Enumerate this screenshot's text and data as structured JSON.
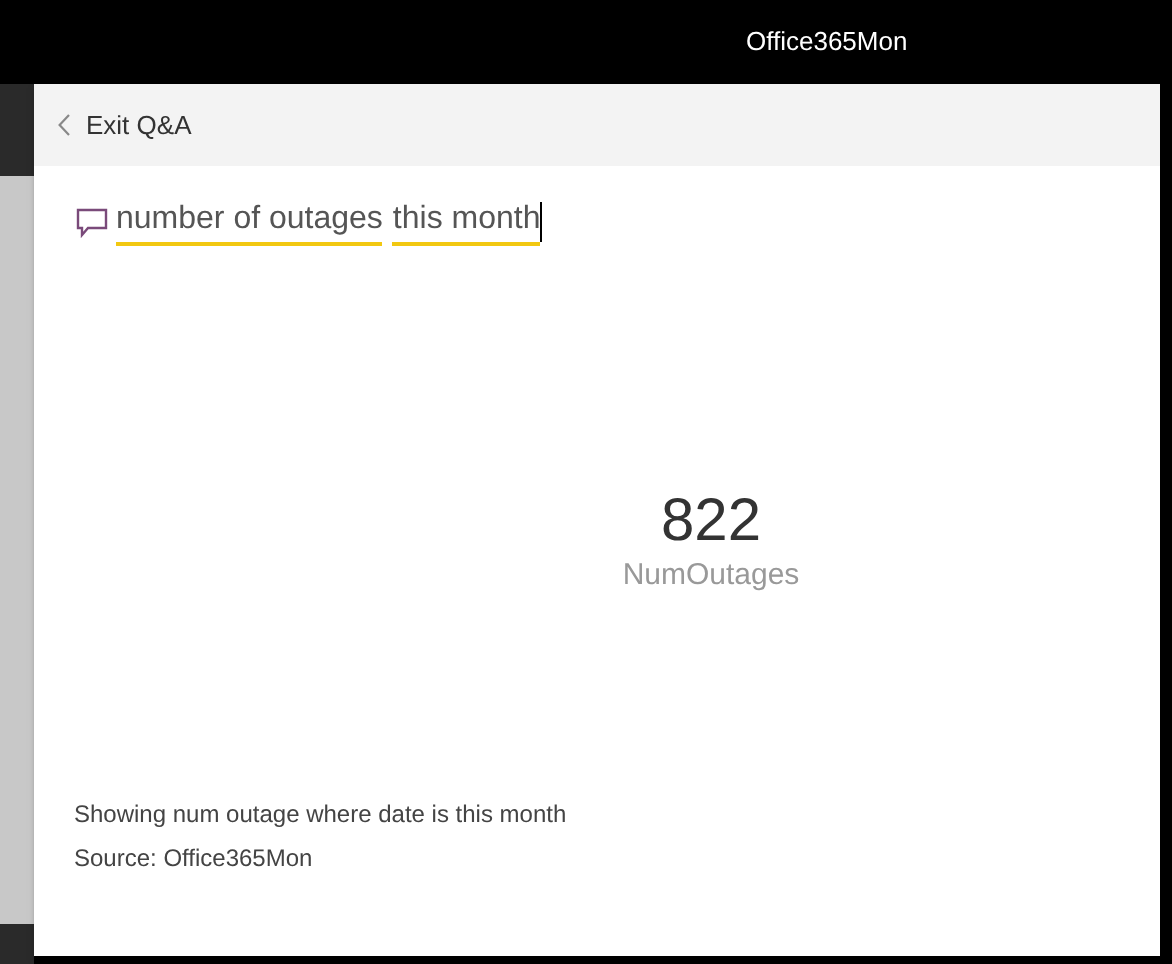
{
  "top_bar": {
    "title": "Office365Mon"
  },
  "header": {
    "back_label": "Exit Q&A"
  },
  "question": {
    "terms": [
      "number of outages",
      "this month"
    ]
  },
  "card": {
    "value": "822",
    "label": "NumOutages"
  },
  "footer": {
    "description": "Showing num outage where date is this month",
    "source": "Source: Office365Mon"
  }
}
